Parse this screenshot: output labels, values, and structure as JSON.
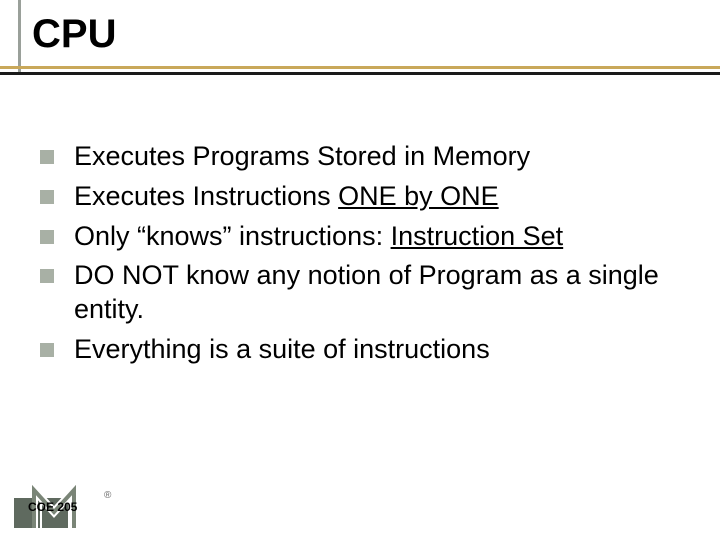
{
  "title": "CPU",
  "bullets": [
    {
      "pre": "Executes Programs Stored in Memory",
      "ul": "",
      "post": ""
    },
    {
      "pre": "Executes Instructions ",
      "ul": "ONE by ONE",
      "post": ""
    },
    {
      "pre": "Only “knows” instructions: ",
      "ul": "Instruction Set",
      "post": ""
    },
    {
      "pre": "DO NOT know any notion of Program as a single entity.",
      "ul": "",
      "post": ""
    },
    {
      "pre": "Everything is a suite of instructions",
      "ul": "",
      "post": ""
    }
  ],
  "footer": {
    "course": "COE 205",
    "registered": "®"
  }
}
